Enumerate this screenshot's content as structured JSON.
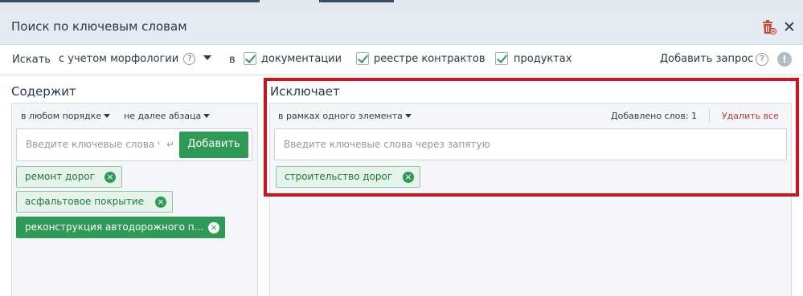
{
  "dialog": {
    "title": "Поиск по ключевым словам",
    "trash_icon": "trash-icon",
    "close_icon": "close-icon",
    "close_glyph": "✕"
  },
  "search": {
    "label": "Искать",
    "morphology": "с учетом морфологии",
    "help_glyph": "?",
    "in_label": "в",
    "checkboxes": [
      {
        "label": "документации",
        "checked": true
      },
      {
        "label": "реестре контрактов",
        "checked": true
      },
      {
        "label": "продуктах",
        "checked": true
      }
    ],
    "add_query": "Добавить запрос",
    "warn_glyph": "!"
  },
  "contains": {
    "title": "Содержит",
    "order_option": "в любом порядке",
    "distance_option": "не далее абзаца",
    "input_placeholder": "Введите ключевые слова через запятую",
    "enter_glyph": "↵",
    "add_button": "Добавить",
    "tags": [
      {
        "label": "ремонт дорог",
        "active": false
      },
      {
        "label": "асфальтовое покрытие",
        "active": false
      },
      {
        "label": "реконструкция автодорожного п...",
        "active": true
      }
    ],
    "tag_remove_glyph": "×"
  },
  "excludes": {
    "title": "Исключает",
    "scope_option": "в рамках одного элемента",
    "added_count": "Добавлено слов: 1",
    "delete_all": "Удалить все",
    "input_placeholder": "Введите ключевые слова через запятую",
    "tags": [
      {
        "label": "строительство дорог",
        "active": false
      }
    ]
  },
  "colors": {
    "accent_green": "#2e9a55",
    "highlight_red": "#d0121c",
    "danger_text": "#b23a3a"
  }
}
